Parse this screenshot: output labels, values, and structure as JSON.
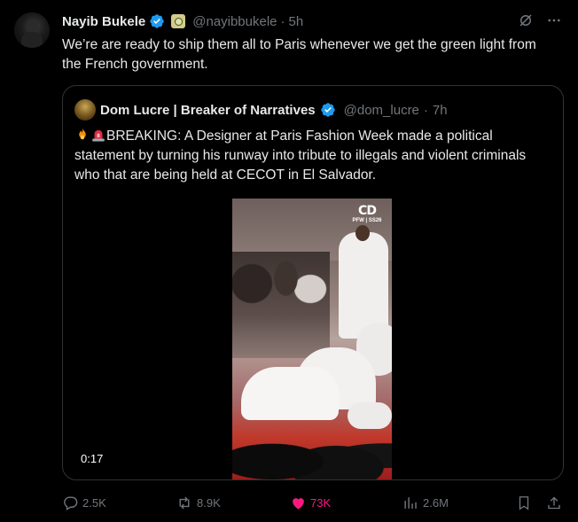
{
  "post": {
    "author_name": "Nayib Bukele",
    "handle": "@nayibbukele",
    "separator": "·",
    "time": "5h",
    "text": "We’re are ready to ship them all to Paris whenever we get the green light from the French government."
  },
  "quoted": {
    "author_name": "Dom Lucre | Breaker of Narratives",
    "handle": "@dom_lucre",
    "separator": "·",
    "time": "7h",
    "text": "BREAKING: A Designer at Paris Fashion Week made a political statement by turning his runway into tribute to illegals and violent criminals who that are being held at CECOT in El Salvador.",
    "video": {
      "duration": "0:17",
      "logo_mark": "CD",
      "logo_text": "PFW | SS26"
    }
  },
  "actions": {
    "replies": "2.5K",
    "reposts": "8.9K",
    "likes": "73K",
    "views": "2.6M"
  },
  "icons": {
    "verified": "verified-badge-icon",
    "affiliate": "affiliate-badge-icon",
    "grok": "grok-icon",
    "more": "more-icon",
    "reply": "reply-icon",
    "repost": "repost-icon",
    "like": "heart-icon",
    "views": "views-icon",
    "bookmark": "bookmark-icon",
    "share": "share-icon"
  },
  "colors": {
    "background": "#000000",
    "text": "#e7e9ea",
    "muted": "#71767b",
    "verified": "#1d9bf0",
    "liked": "#f91880",
    "border": "#2f3336"
  }
}
